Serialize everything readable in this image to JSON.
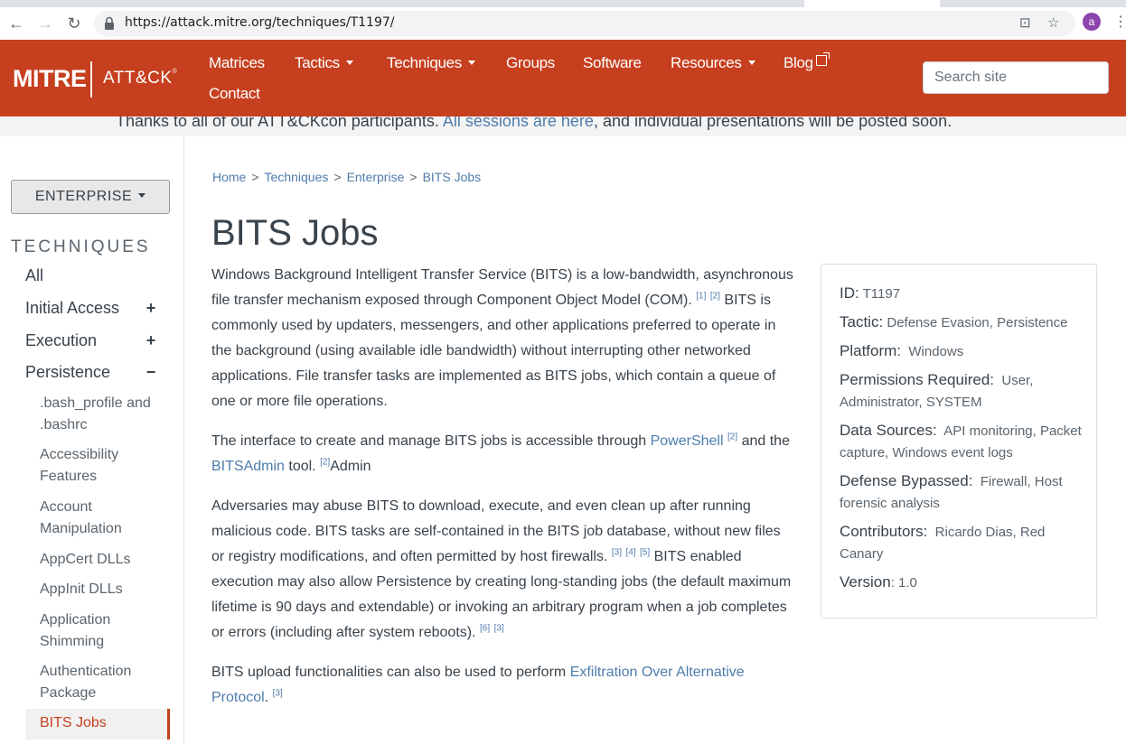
{
  "browser": {
    "url": "https://attack.mitre.org/techniques/T1197/",
    "avatar_letter": "a"
  },
  "header": {
    "logo_mitre": "MITRE",
    "logo_attck": "ATT&CK",
    "logo_tm": "®",
    "nav": {
      "matrices": "Matrices",
      "tactics": "Tactics",
      "techniques": "Techniques",
      "groups": "Groups",
      "software": "Software",
      "resources": "Resources",
      "blog": "Blog",
      "contact": "Contact"
    },
    "search_placeholder": "Search site"
  },
  "banner": {
    "text_before": "Thanks to all of our ATT&CKcon participants. ",
    "link": "All sessions are here",
    "text_after": ", and individual presentations will be posted soon."
  },
  "sidebar": {
    "domain_button": "ENTERPRISE",
    "heading": "TECHNIQUES",
    "items": [
      {
        "label": "All",
        "toggle": ""
      },
      {
        "label": "Initial Access",
        "toggle": "+"
      },
      {
        "label": "Execution",
        "toggle": "+"
      },
      {
        "label": "Persistence",
        "toggle": "−"
      }
    ],
    "sub_items": [
      ".bash_profile and .bashrc",
      "Accessibility Features",
      "Account Manipulation",
      "AppCert DLLs",
      "AppInit DLLs",
      "Application Shimming",
      "Authentication Package"
    ],
    "active_item": "BITS Jobs"
  },
  "breadcrumb": [
    "Home",
    "Techniques",
    "Enterprise",
    "BITS Jobs"
  ],
  "breadcrumb_sep": ">",
  "page_title": "BITS Jobs",
  "paragraphs": {
    "p1_a": "Windows Background Intelligent Transfer Service (BITS) is a low-bandwidth, asynchronous file transfer mechanism exposed through Component Object Model (COM).",
    "p1_ref1": "[1]",
    "p1_ref2": "[2]",
    "p1_b": "BITS is commonly used by updaters, messengers, and other applications preferred to operate in the background (using available idle bandwidth) without interrupting other networked applications. File transfer tasks are implemented as BITS jobs, which contain a queue of one or more file operations.",
    "p2_a": "The interface to create and manage BITS jobs is accessible through",
    "p2_link1": "PowerShell",
    "p2_ref1": "[2]",
    "p2_b": "and the",
    "p2_link2": "BITSAdmin",
    "p2_c": "tool.",
    "p2_ref2": "[2]",
    "p2_d": "Admin",
    "p3_a": "Adversaries may abuse BITS to download, execute, and even clean up after running malicious code. BITS tasks are self-contained in the BITS job database, without new files or registry modifications, and often permitted by host firewalls.",
    "p3_ref3": "[3]",
    "p3_ref4": "[4]",
    "p3_ref5": "[5]",
    "p3_b": "BITS enabled execution may also allow Persistence by creating long-standing jobs (the default maximum lifetime is 90 days and extendable) or invoking an arbitrary program when a job completes or errors (including after system reboots).",
    "p3_ref6": "[6]",
    "p3_ref7": "[3]",
    "p4_a": "BITS upload functionalities can also be used to perform",
    "p4_link": "Exfiltration Over Alternative Protocol",
    "p4_ref": "[3]"
  },
  "card": {
    "id_label": "ID:",
    "id_value": "T1197",
    "tactic_label": "Tactic:",
    "tactic_value": "Defense Evasion, Persistence",
    "platform_label": "Platform:",
    "platform_value": "Windows",
    "permissions_label": "Permissions Required:",
    "permissions_value": "User, Administrator, SYSTEM",
    "datasources_label": "Data Sources:",
    "datasources_value": "API monitoring, Packet capture, Windows event logs",
    "bypassed_label": "Defense Bypassed:",
    "bypassed_value": "Firewall, Host forensic analysis",
    "contributors_label": "Contributors:",
    "contributors_value": "Ricardo Dias, Red Canary",
    "version_label": "Version",
    "version_value": "1.0"
  },
  "colors": {
    "brand": "#c63f1f",
    "link": "#4f7cac",
    "text": "#39434c"
  }
}
